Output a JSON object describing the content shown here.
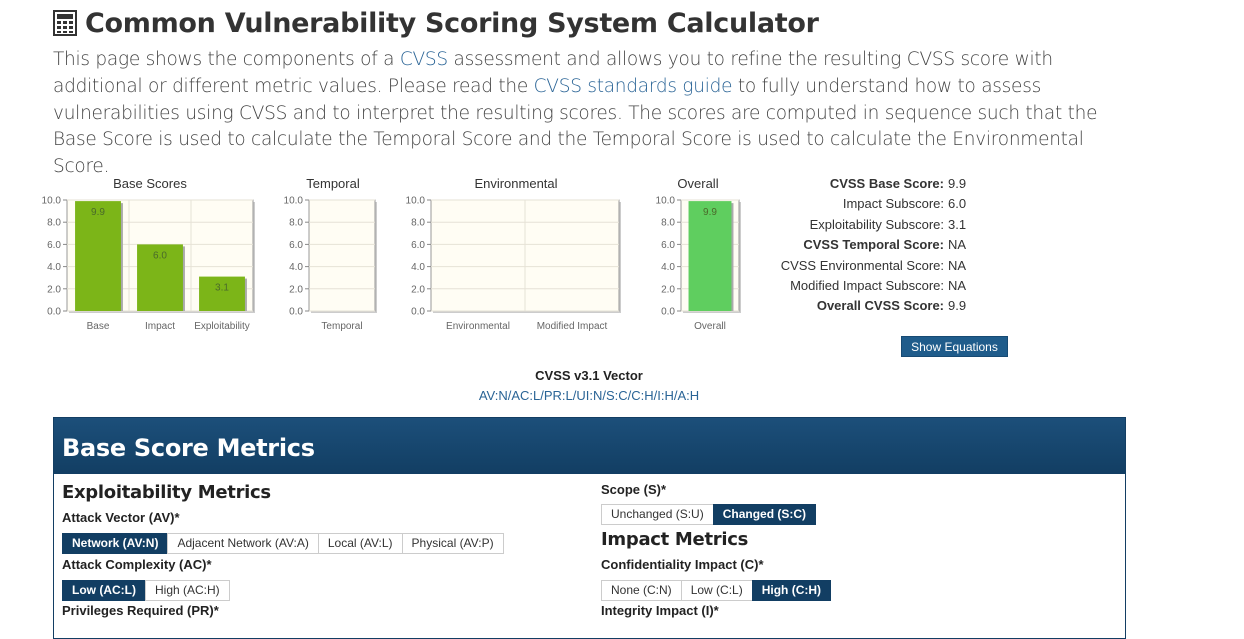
{
  "header": {
    "title": "Common Vulnerability Scoring System Calculator",
    "icon": "calculator-icon"
  },
  "intro": {
    "p1": "This page shows the components of a ",
    "link1": "CVSS",
    "p2": " assessment and allows you to refine the resulting CVSS score with additional or different metric values. Please read the ",
    "link2": "CVSS standards guide",
    "p3": " to fully understand how to assess vulnerabilities using CVSS and to interpret the resulting scores. The scores are computed in sequence such that the Base Score is used to calculate the Temporal Score and the Temporal Score is used to calculate the Environmental Score."
  },
  "chart_data": [
    {
      "type": "bar",
      "title": "Base Scores",
      "categories": [
        "Base",
        "Impact",
        "Exploitability"
      ],
      "values": [
        9.9,
        6.0,
        3.1
      ],
      "ylim": [
        0,
        10
      ],
      "yticks": [
        "0.0",
        "2.0",
        "4.0",
        "6.0",
        "8.0",
        "10.0"
      ],
      "grid": true,
      "color": "#7cb518"
    },
    {
      "type": "bar",
      "title": "Temporal",
      "categories": [
        "Temporal"
      ],
      "values": [],
      "ylim": [
        0,
        10
      ],
      "yticks": [
        "0.0",
        "2.0",
        "4.0",
        "6.0",
        "8.0",
        "10.0"
      ],
      "grid": true
    },
    {
      "type": "bar",
      "title": "Environmental",
      "categories": [
        "Environmental",
        "Modified Impact"
      ],
      "values": [],
      "ylim": [
        0,
        10
      ],
      "yticks": [
        "0.0",
        "2.0",
        "4.0",
        "6.0",
        "8.0",
        "10.0"
      ],
      "grid": true
    },
    {
      "type": "bar",
      "title": "Overall",
      "categories": [
        "Overall"
      ],
      "values": [
        9.9
      ],
      "ylim": [
        0,
        10
      ],
      "yticks": [
        "0.0",
        "2.0",
        "4.0",
        "6.0",
        "8.0",
        "10.0"
      ],
      "grid": true,
      "color": "#5fce5f"
    }
  ],
  "scores": [
    {
      "label": "CVSS Base Score:",
      "value": "9.9",
      "bold": true
    },
    {
      "label": "Impact Subscore:",
      "value": "6.0",
      "bold": false
    },
    {
      "label": "Exploitability Subscore:",
      "value": "3.1",
      "bold": false
    },
    {
      "label": "CVSS Temporal Score:",
      "value": "NA",
      "bold": true
    },
    {
      "label": "CVSS Environmental Score:",
      "value": "NA",
      "bold": false
    },
    {
      "label": "Modified Impact Subscore:",
      "value": "NA",
      "bold": false
    },
    {
      "label": "Overall CVSS Score:",
      "value": "9.9",
      "bold": true
    }
  ],
  "show_equations": "Show Equations",
  "vector": {
    "label": "CVSS v3.1 Vector",
    "value": "AV:N/AC:L/PR:L/UI:N/S:C/C:H/I:H/A:H"
  },
  "panel": {
    "title": "Base Score Metrics",
    "exploitability_title": "Exploitability Metrics",
    "impact_title": "Impact Metrics"
  },
  "metrics": {
    "av": {
      "label": "Attack Vector (AV)*",
      "options": [
        "Network (AV:N)",
        "Adjacent Network (AV:A)",
        "Local (AV:L)",
        "Physical (AV:P)"
      ],
      "selected": 0
    },
    "ac": {
      "label": "Attack Complexity (AC)*",
      "options": [
        "Low (AC:L)",
        "High (AC:H)"
      ],
      "selected": 0
    },
    "pr": {
      "label": "Privileges Required (PR)*"
    },
    "s": {
      "label": "Scope (S)*",
      "options": [
        "Unchanged (S:U)",
        "Changed (S:C)"
      ],
      "selected": 1
    },
    "c": {
      "label": "Confidentiality Impact (C)*",
      "options": [
        "None (C:N)",
        "Low (C:L)",
        "High (C:H)"
      ],
      "selected": 2
    },
    "i": {
      "label": "Integrity Impact (I)*"
    }
  }
}
